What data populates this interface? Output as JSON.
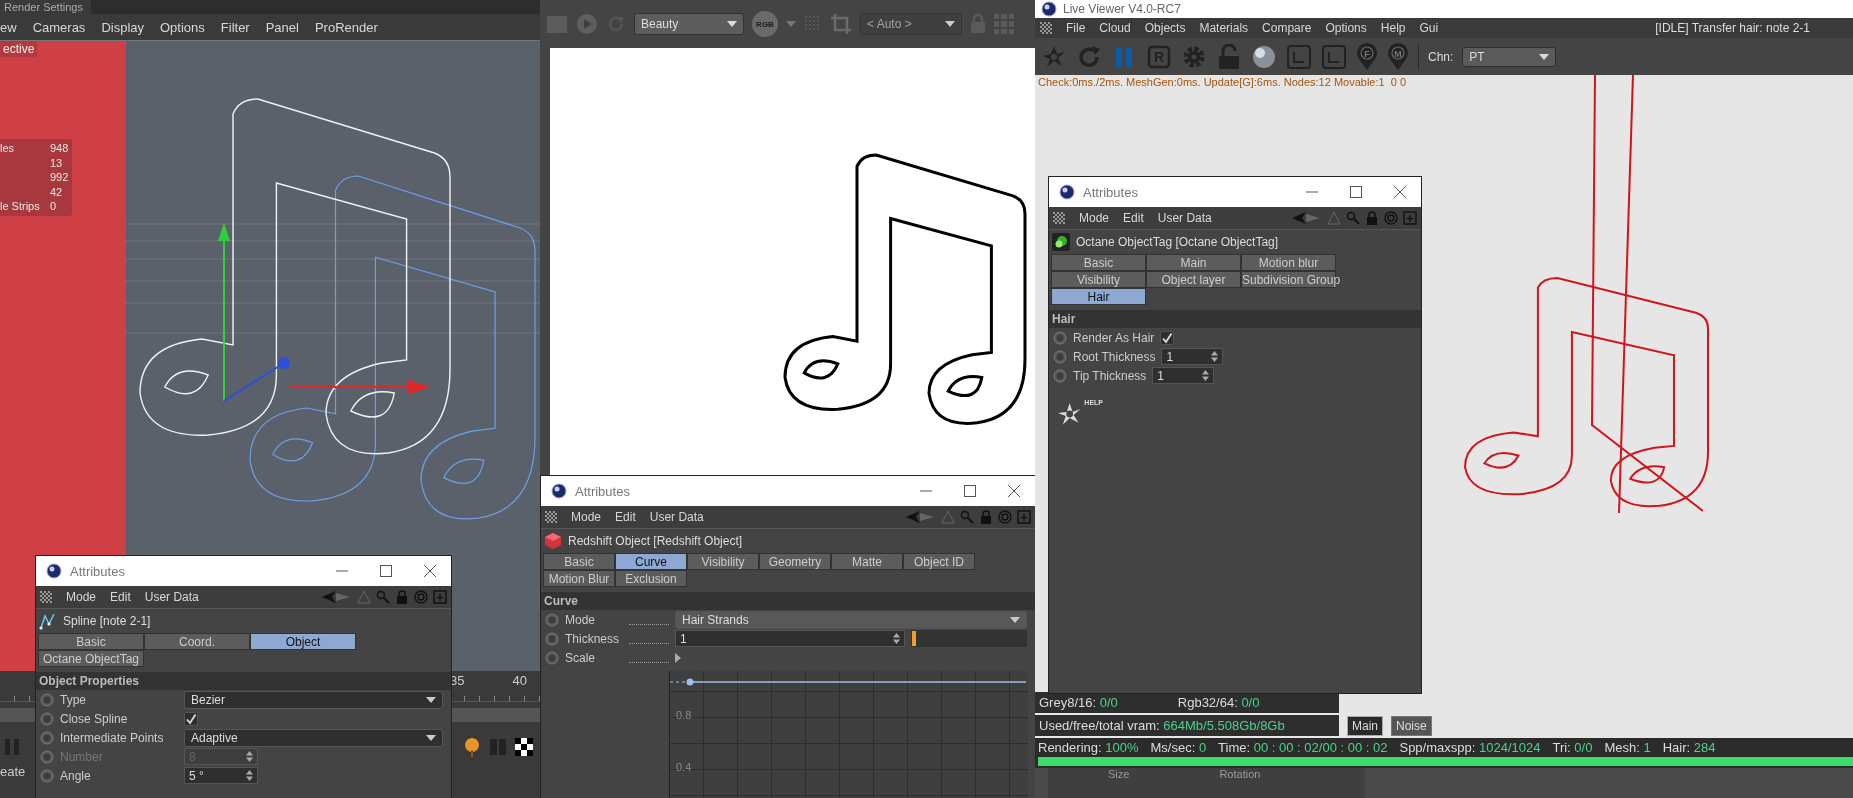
{
  "viewport": {
    "title": "Render Settings",
    "menu": [
      "ew",
      "Cameras",
      "Display",
      "Options",
      "Filter",
      "Panel",
      "ProRender"
    ],
    "view_label": "ective",
    "stats": [
      {
        "label": "les",
        "value": "948"
      },
      {
        "value": "13"
      },
      {
        "value": "992"
      },
      {
        "value": "42"
      },
      {
        "label": "le Strips",
        "value": "0"
      }
    ],
    "timeline_ticks": [
      "35",
      "40"
    ],
    "button_label": "eate"
  },
  "spline_attributes": {
    "title": "Attributes",
    "menu": [
      "Mode",
      "Edit",
      "User Data"
    ],
    "object": "Spline [note 2-1]",
    "tabs": [
      {
        "label": "Basic",
        "selected": false
      },
      {
        "label": "Coord.",
        "selected": false
      },
      {
        "label": "Object",
        "selected": true
      },
      {
        "label": "Octane ObjectTag",
        "selected": false
      }
    ],
    "section": "Object Properties",
    "rows": [
      {
        "kind": "dropdown",
        "label": "Type",
        "value": "Bezier",
        "disabled": false
      },
      {
        "kind": "checkbox",
        "label": "Close Spline",
        "checked": true,
        "disabled": false
      },
      {
        "kind": "dropdown",
        "label": "Intermediate Points",
        "value": "Adaptive",
        "disabled": false
      },
      {
        "kind": "number",
        "label": "Number",
        "value": "8",
        "disabled": true
      },
      {
        "kind": "number",
        "label": "Angle",
        "value": "5 °",
        "disabled": false
      }
    ]
  },
  "render_view": {
    "pass": "Beauty",
    "color_mode": "RGB",
    "region": "< Auto >"
  },
  "redshift_attributes": {
    "title": "Attributes",
    "menu": [
      "Mode",
      "Edit",
      "User Data"
    ],
    "object": "Redshift Object [Redshift Object]",
    "tabs": [
      {
        "label": "Basic",
        "selected": false
      },
      {
        "label": "Curve",
        "selected": true
      },
      {
        "label": "Visibility",
        "selected": false
      },
      {
        "label": "Geometry",
        "selected": false
      },
      {
        "label": "Matte",
        "selected": false
      },
      {
        "label": "Object ID",
        "selected": false
      },
      {
        "label": "Motion Blur",
        "selected": false
      },
      {
        "label": "Exclusion",
        "selected": false
      }
    ],
    "section": "Curve",
    "rows": [
      {
        "kind": "dropdown",
        "label": "Mode",
        "value": "Hair Strands"
      },
      {
        "kind": "slider",
        "label": "Thickness",
        "value": "1",
        "level": 0.01
      },
      {
        "kind": "graph",
        "label": "Scale",
        "ticks": [
          "0.8",
          "0.4"
        ]
      }
    ]
  },
  "live_viewer": {
    "title": "Live Viewer V4.0-RC7",
    "menu": [
      "File",
      "Cloud",
      "Objects",
      "Materials",
      "Compare",
      "Options",
      "Help",
      "Gui"
    ],
    "status": "[IDLE] Transfer hair: note 2-1",
    "toolbar": [
      {
        "kind": "octane"
      },
      {
        "kind": "refresh"
      },
      {
        "kind": "pause"
      },
      {
        "kind": "letter",
        "label": "R"
      },
      {
        "kind": "gear"
      },
      {
        "kind": "lock"
      },
      {
        "kind": "sphere"
      },
      {
        "kind": "frame"
      },
      {
        "kind": "frame"
      },
      {
        "kind": "pin",
        "label": "F"
      },
      {
        "kind": "pin",
        "label": "M"
      }
    ],
    "channel_label": "Chn:",
    "channel": "PT",
    "timing": "Check:0ms./2ms. MeshGen:0ms. Update[G]:6ms. Nodes:12 Movable:1  0 0",
    "octane_attributes": {
      "title": "Attributes",
      "menu": [
        "Mode",
        "Edit",
        "User Data"
      ],
      "object": "Octane ObjectTag [Octane ObjectTag]",
      "tabs": [
        {
          "label": "Basic",
          "selected": false
        },
        {
          "label": "Main",
          "selected": false
        },
        {
          "label": "Motion blur",
          "selected": false
        },
        {
          "label": "Visibility",
          "selected": false
        },
        {
          "label": "Object layer",
          "selected": false
        },
        {
          "label": "Subdivision Group",
          "selected": false
        },
        {
          "label": "Hair",
          "selected": true
        }
      ],
      "section": "Hair",
      "rows": [
        {
          "kind": "checkbox",
          "label": "Render As Hair",
          "checked": true
        },
        {
          "kind": "number",
          "label": "Root Thickness",
          "value": "1"
        },
        {
          "kind": "number",
          "label": "Tip Thickness",
          "value": "1"
        }
      ],
      "help_label": "HELP"
    },
    "memory": [
      {
        "label": "Grey8/16:",
        "value": "0/0"
      },
      {
        "label": "Rgb32/64:",
        "value": "0/0"
      }
    ],
    "vram": {
      "label": "Used/free/total vram:",
      "value": "664Mb/5.508Gb/8Gb"
    },
    "view_tabs": [
      {
        "label": "Main",
        "selected": true
      },
      {
        "label": "Noise",
        "selected": false
      }
    ],
    "render_stats": [
      {
        "label": "Rendering:",
        "value": "100%"
      },
      {
        "label": "Ms/sec:",
        "value": "0"
      },
      {
        "label": "Time:",
        "value": "00 : 00 : 02/00 : 00 : 02"
      },
      {
        "label": "Spp/maxspp:",
        "value": "1024/1024"
      },
      {
        "label": "Tri:",
        "value": "0/0"
      },
      {
        "label": "Mesh:",
        "value": "1"
      },
      {
        "label": "Hair:",
        "value": "284"
      }
    ],
    "progress": {
      "level": 1
    },
    "coord_headers": [
      "Size",
      "Rotation"
    ]
  }
}
